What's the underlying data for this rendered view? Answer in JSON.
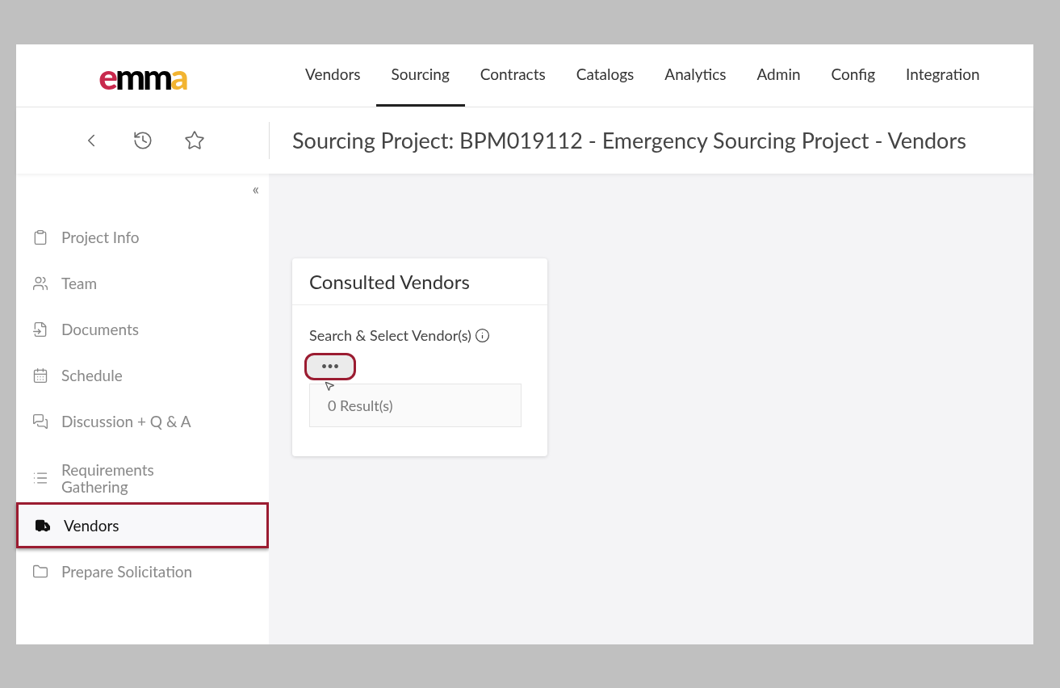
{
  "logo": {
    "text": "emma"
  },
  "nav": [
    {
      "label": "Vendors",
      "selected": false
    },
    {
      "label": "Sourcing",
      "selected": true
    },
    {
      "label": "Contracts",
      "selected": false
    },
    {
      "label": "Catalogs",
      "selected": false
    },
    {
      "label": "Analytics",
      "selected": false
    },
    {
      "label": "Admin",
      "selected": false
    },
    {
      "label": "Config",
      "selected": false
    },
    {
      "label": "Integration",
      "selected": false
    }
  ],
  "page_title": "Sourcing Project: BPM019112 - Emergency Sourcing Project - Vendors",
  "sidebar": {
    "collapse": "«",
    "items": [
      {
        "label": "Project Info",
        "selected": false
      },
      {
        "label": "Team",
        "selected": false
      },
      {
        "label": "Documents",
        "selected": false
      },
      {
        "label": "Schedule",
        "selected": false
      },
      {
        "label": "Discussion + Q & A",
        "selected": false
      },
      {
        "label": "Requirements Gathering",
        "selected": false
      },
      {
        "label": "Vendors",
        "selected": true
      },
      {
        "label": "Prepare Solicitation",
        "selected": false
      }
    ]
  },
  "card": {
    "title": "Consulted Vendors",
    "field_label": "Search & Select Vendor(s)",
    "more_button": {
      "label": "•••",
      "highlighted": true
    },
    "results": "0 Result(s)"
  }
}
